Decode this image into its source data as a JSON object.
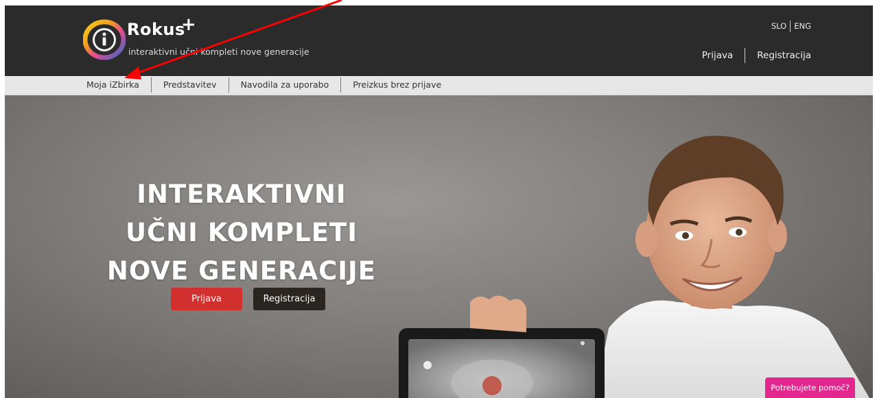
{
  "brand": {
    "name": "Rokus",
    "plus": "+",
    "tagline": "interaktivni učni kompleti nove generacije"
  },
  "languages": [
    "SLO",
    "ENG"
  ],
  "account": {
    "login": "Prijava",
    "register": "Registracija"
  },
  "nav": {
    "items": [
      "Moja iZbirka",
      "Predstavitev",
      "Navodila za uporabo",
      "Preizkus brez prijave"
    ]
  },
  "hero": {
    "headline_line1": "INTERAKTIVNI",
    "headline_line2": "UČNI KOMPLETI",
    "headline_line3": "NOVE GENERACIJE",
    "login_button": "Prijava",
    "register_button": "Registracija"
  },
  "help": {
    "label": "Potrebujete pomoč?"
  },
  "colors": {
    "topbar": "#2b2b2b",
    "navbar": "#e7e7e7",
    "login_button": "#d2302f",
    "register_button": "#2a2520",
    "help_button": "#e3278f",
    "annotation_arrow": "#ff0000"
  }
}
